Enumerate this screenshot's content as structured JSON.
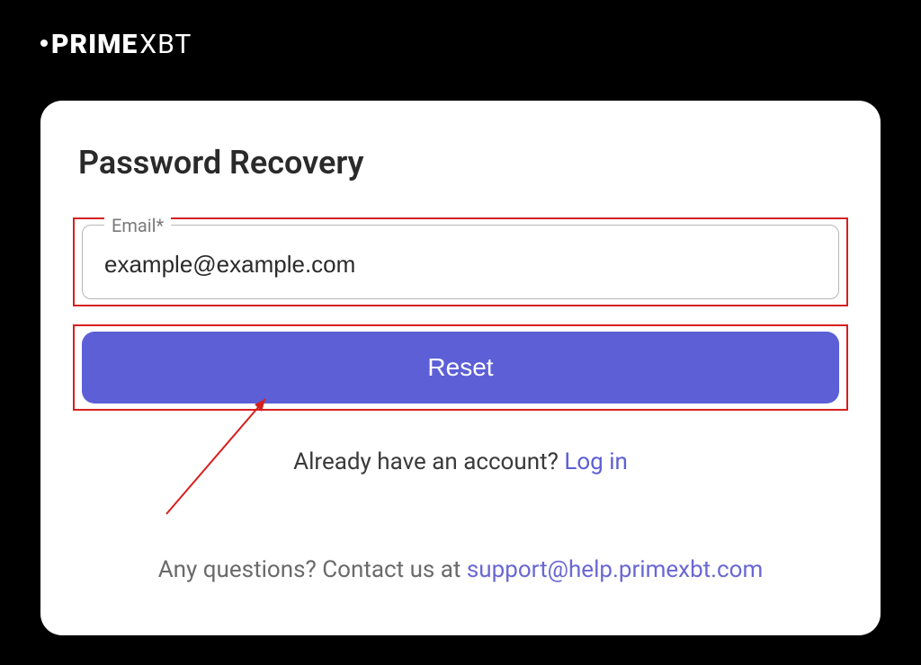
{
  "logo": {
    "prime": "PRIME",
    "xbt": "XBT"
  },
  "card": {
    "title": "Password Recovery",
    "email_label": "Email*",
    "email_value": "example@example.com",
    "reset_label": "Reset",
    "login_prompt": "Already have an account? ",
    "login_link": "Log in",
    "support_prompt": "Any questions? Contact us at ",
    "support_email": "support@help.primexbt.com"
  }
}
